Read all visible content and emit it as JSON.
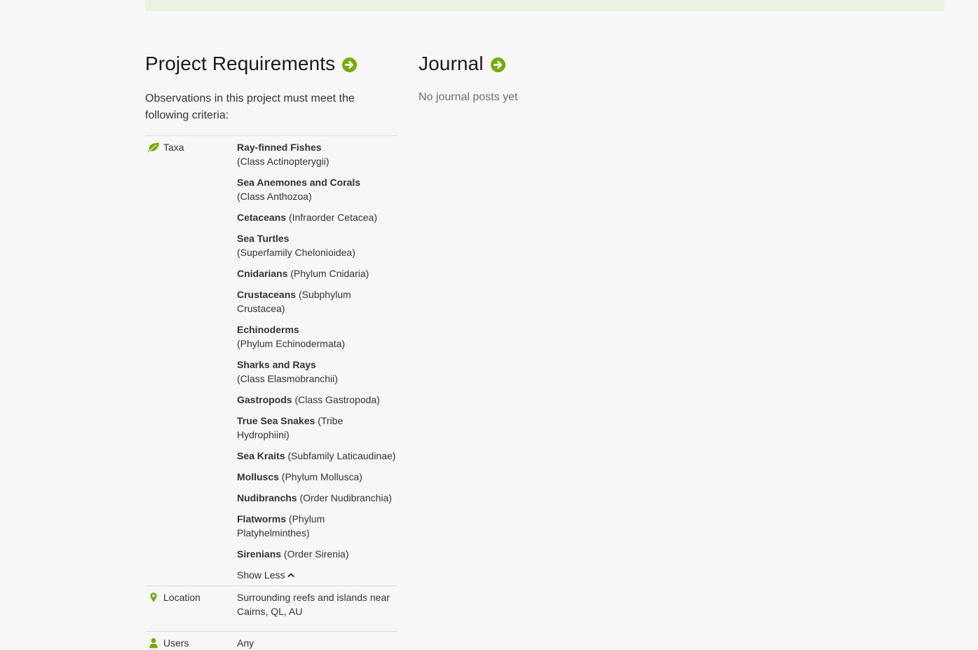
{
  "colors": {
    "accent": "#74ac00",
    "banner": "#ebf2e1",
    "background": "#f7f7f7"
  },
  "requirements": {
    "title": "Project Requirements",
    "intro": "Observations in this project must meet the following criteria:",
    "taxa_label": "Taxa",
    "taxa": [
      {
        "common": "Ray-finned Fishes",
        "rank": "(Class Actinopterygii)",
        "wrap": true
      },
      {
        "common": "Sea Anemones and Corals",
        "rank": "(Class Anthozoa)",
        "wrap": true
      },
      {
        "common": "Cetaceans",
        "rank": "(Infraorder Cetacea)",
        "wrap": false
      },
      {
        "common": "Sea Turtles",
        "rank": "(Superfamily Chelonioidea)",
        "wrap": true
      },
      {
        "common": "Cnidarians",
        "rank": "(Phylum Cnidaria)",
        "wrap": false
      },
      {
        "common": "Crustaceans",
        "rank": "(Subphylum Crustacea)",
        "wrap": false
      },
      {
        "common": "Echinoderms",
        "rank": "(Phylum Echinodermata)",
        "wrap": true
      },
      {
        "common": "Sharks and Rays",
        "rank": "(Class Elasmobranchii)",
        "wrap": true
      },
      {
        "common": "Gastropods",
        "rank": "(Class Gastropoda)",
        "wrap": false
      },
      {
        "common": "True Sea Snakes",
        "rank": "(Tribe Hydrophiini)",
        "wrap": false
      },
      {
        "common": "Sea Kraits",
        "rank": "(Subfamily Laticaudinae)",
        "wrap": false
      },
      {
        "common": "Molluscs",
        "rank": "(Phylum Mollusca)",
        "wrap": false
      },
      {
        "common": "Nudibranchs",
        "rank": "(Order Nudibranchia)",
        "wrap": false
      },
      {
        "common": "Flatworms",
        "rank": "(Phylum Platyhelminthes)",
        "wrap": false
      },
      {
        "common": "Sirenians",
        "rank": "(Order Sirenia)",
        "wrap": false
      }
    ],
    "show_less": "Show Less",
    "location_label": "Location",
    "location_value": "Surrounding reefs and islands near Cairns, QL, AU",
    "users_label": "Users",
    "users_value": "Any"
  },
  "journal": {
    "title": "Journal",
    "empty_text": "No journal posts yet"
  },
  "icons": {
    "heading_arrow": "arrow-circle-right-icon",
    "taxa": "leaf-icon",
    "location": "map-marker-icon",
    "users": "user-icon",
    "show_less": "chevron-up-icon"
  }
}
